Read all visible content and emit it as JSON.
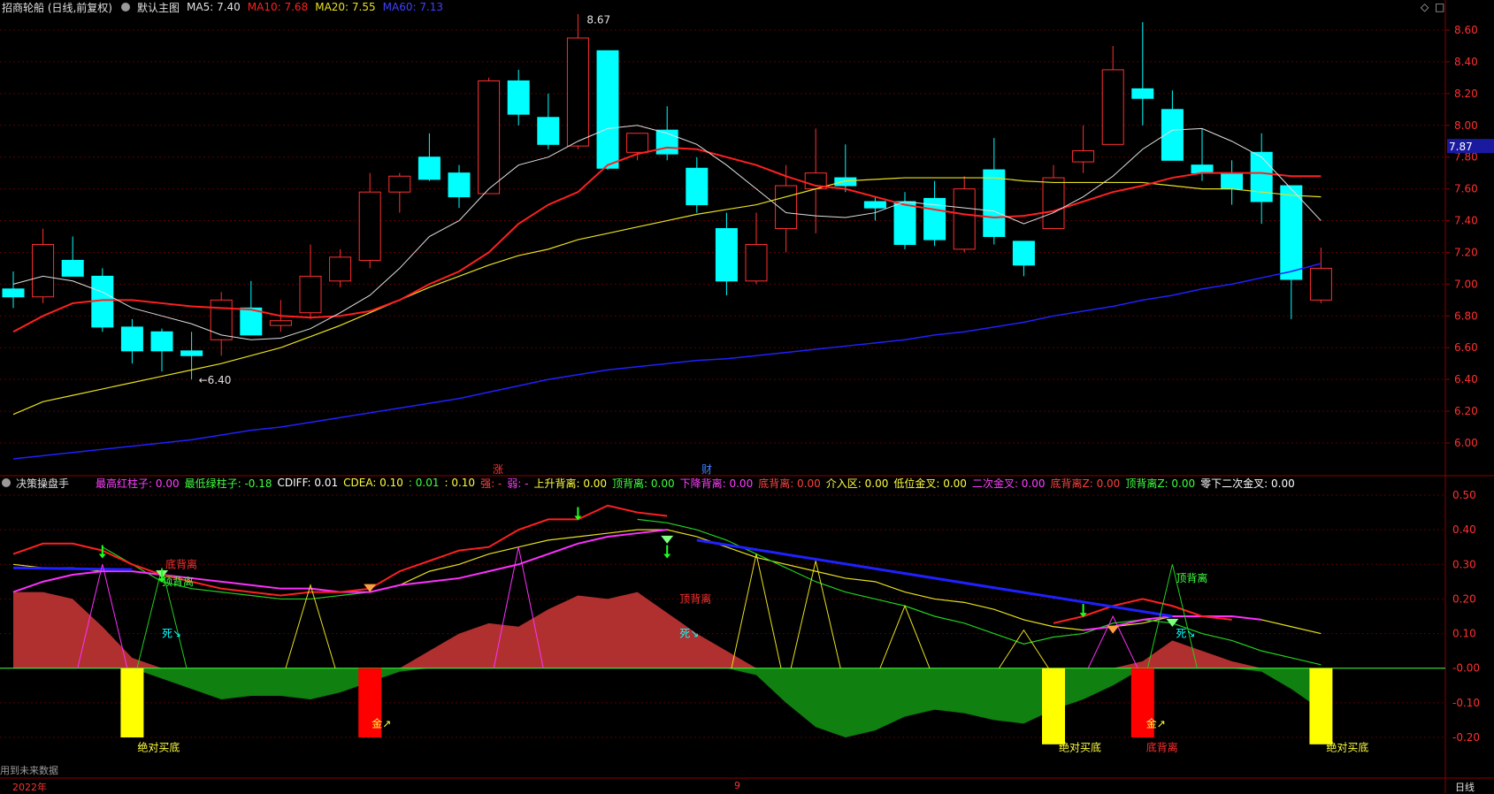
{
  "header": {
    "title": "招商轮船 (日线,前复权)",
    "main_chart": "默认主图",
    "ma5": "MA5: 7.40",
    "ma10": "MA10: 7.68",
    "ma20": "MA20: 7.55",
    "ma60": "MA60: 7.13"
  },
  "colors": {
    "up": "#ff3030",
    "down": "#00ffff",
    "ma5": "#e0e0e0",
    "ma10": "#ff2020",
    "ma20": "#e8e020",
    "ma60": "#2020ff",
    "cyan": "#00ffff"
  },
  "price_axis": [
    "8.60",
    "8.40",
    "8.20",
    "8.00",
    "7.80",
    "7.60",
    "7.40",
    "7.20",
    "7.00",
    "6.80",
    "6.60",
    "6.40",
    "6.20",
    "6.00"
  ],
  "current_price": "7.87",
  "high_label": "8.67",
  "low_label": "6.40",
  "candles": [
    {
      "o": 6.97,
      "h": 7.08,
      "l": 6.85,
      "c": 6.92
    },
    {
      "o": 6.92,
      "h": 7.35,
      "l": 6.88,
      "c": 7.25
    },
    {
      "o": 7.15,
      "h": 7.3,
      "l": 7.08,
      "c": 7.05
    },
    {
      "o": 7.05,
      "h": 7.1,
      "l": 6.7,
      "c": 6.73
    },
    {
      "o": 6.73,
      "h": 6.78,
      "l": 6.5,
      "c": 6.58
    },
    {
      "o": 6.7,
      "h": 6.72,
      "l": 6.45,
      "c": 6.58
    },
    {
      "o": 6.58,
      "h": 6.7,
      "l": 6.4,
      "c": 6.55
    },
    {
      "o": 6.65,
      "h": 6.95,
      "l": 6.55,
      "c": 6.9
    },
    {
      "o": 6.85,
      "h": 7.02,
      "l": 6.7,
      "c": 6.68
    },
    {
      "o": 6.74,
      "h": 6.9,
      "l": 6.7,
      "c": 6.77
    },
    {
      "o": 6.82,
      "h": 7.25,
      "l": 6.78,
      "c": 7.05
    },
    {
      "o": 7.02,
      "h": 7.22,
      "l": 6.98,
      "c": 7.17
    },
    {
      "o": 7.15,
      "h": 7.7,
      "l": 7.1,
      "c": 7.58
    },
    {
      "o": 7.58,
      "h": 7.7,
      "l": 7.45,
      "c": 7.68
    },
    {
      "o": 7.8,
      "h": 7.95,
      "l": 7.65,
      "c": 7.66
    },
    {
      "o": 7.7,
      "h": 7.75,
      "l": 7.48,
      "c": 7.55
    },
    {
      "o": 7.57,
      "h": 8.3,
      "l": 7.57,
      "c": 8.28
    },
    {
      "o": 8.28,
      "h": 8.35,
      "l": 8.0,
      "c": 8.07
    },
    {
      "o": 8.05,
      "h": 8.2,
      "l": 7.85,
      "c": 7.88
    },
    {
      "o": 7.87,
      "h": 8.7,
      "l": 7.85,
      "c": 8.55
    },
    {
      "o": 8.47,
      "h": 8.47,
      "l": 7.72,
      "c": 7.73
    },
    {
      "o": 7.83,
      "h": 7.95,
      "l": 7.78,
      "c": 7.95
    },
    {
      "o": 7.97,
      "h": 8.12,
      "l": 7.78,
      "c": 7.82
    },
    {
      "o": 7.73,
      "h": 7.8,
      "l": 7.45,
      "c": 7.5
    },
    {
      "o": 7.35,
      "h": 7.45,
      "l": 6.93,
      "c": 7.02
    },
    {
      "o": 7.02,
      "h": 7.45,
      "l": 7.0,
      "c": 7.25
    },
    {
      "o": 7.35,
      "h": 7.75,
      "l": 7.2,
      "c": 7.62
    },
    {
      "o": 7.6,
      "h": 7.98,
      "l": 7.32,
      "c": 7.7
    },
    {
      "o": 7.67,
      "h": 7.88,
      "l": 7.58,
      "c": 7.62
    },
    {
      "o": 7.52,
      "h": 7.55,
      "l": 7.4,
      "c": 7.48
    },
    {
      "o": 7.52,
      "h": 7.58,
      "l": 7.22,
      "c": 7.25
    },
    {
      "o": 7.54,
      "h": 7.65,
      "l": 7.24,
      "c": 7.28
    },
    {
      "o": 7.22,
      "h": 7.68,
      "l": 7.2,
      "c": 7.6
    },
    {
      "o": 7.72,
      "h": 7.92,
      "l": 7.25,
      "c": 7.3
    },
    {
      "o": 7.27,
      "h": 7.27,
      "l": 7.05,
      "c": 7.12
    },
    {
      "o": 7.35,
      "h": 7.75,
      "l": 7.35,
      "c": 7.67
    },
    {
      "o": 7.77,
      "h": 8.0,
      "l": 7.7,
      "c": 7.84
    },
    {
      "o": 7.88,
      "h": 8.5,
      "l": 7.88,
      "c": 8.35
    },
    {
      "o": 8.23,
      "h": 8.65,
      "l": 8.0,
      "c": 8.17
    },
    {
      "o": 8.1,
      "h": 8.22,
      "l": 7.78,
      "c": 7.78
    },
    {
      "o": 7.75,
      "h": 7.98,
      "l": 7.65,
      "c": 7.7
    },
    {
      "o": 7.7,
      "h": 7.78,
      "l": 7.5,
      "c": 7.6
    },
    {
      "o": 7.83,
      "h": 7.95,
      "l": 7.38,
      "c": 7.52
    },
    {
      "o": 7.62,
      "h": 7.62,
      "l": 6.78,
      "c": 7.03
    },
    {
      "o": 6.9,
      "h": 7.23,
      "l": 6.88,
      "c": 7.1
    }
  ],
  "ma5_line": [
    7.0,
    7.05,
    7.02,
    6.95,
    6.85,
    6.8,
    6.75,
    6.68,
    6.65,
    6.66,
    6.72,
    6.82,
    6.93,
    7.1,
    7.3,
    7.4,
    7.6,
    7.75,
    7.8,
    7.9,
    7.98,
    8.0,
    7.95,
    7.88,
    7.75,
    7.6,
    7.45,
    7.43,
    7.42,
    7.45,
    7.52,
    7.5,
    7.48,
    7.46,
    7.38,
    7.45,
    7.55,
    7.68,
    7.85,
    7.97,
    7.98,
    7.9,
    7.8,
    7.6,
    7.4
  ],
  "ma10_line": [
    6.7,
    6.8,
    6.88,
    6.9,
    6.9,
    6.88,
    6.86,
    6.85,
    6.84,
    6.8,
    6.79,
    6.8,
    6.83,
    6.9,
    7.0,
    7.08,
    7.2,
    7.38,
    7.5,
    7.58,
    7.75,
    7.82,
    7.86,
    7.85,
    7.8,
    7.75,
    7.68,
    7.62,
    7.6,
    7.55,
    7.5,
    7.47,
    7.44,
    7.42,
    7.43,
    7.46,
    7.52,
    7.58,
    7.62,
    7.67,
    7.7,
    7.7,
    7.7,
    7.68,
    7.68
  ],
  "ma20_line": [
    6.18,
    6.26,
    6.3,
    6.34,
    6.38,
    6.42,
    6.46,
    6.5,
    6.55,
    6.6,
    6.67,
    6.74,
    6.82,
    6.9,
    6.98,
    7.05,
    7.12,
    7.18,
    7.22,
    7.28,
    7.32,
    7.36,
    7.4,
    7.44,
    7.47,
    7.5,
    7.55,
    7.6,
    7.65,
    7.66,
    7.67,
    7.67,
    7.67,
    7.67,
    7.65,
    7.64,
    7.64,
    7.64,
    7.64,
    7.62,
    7.6,
    7.6,
    7.58,
    7.56,
    7.55
  ],
  "ma60_line": [
    5.9,
    5.92,
    5.94,
    5.96,
    5.98,
    6.0,
    6.02,
    6.05,
    6.08,
    6.1,
    6.13,
    6.16,
    6.19,
    6.22,
    6.25,
    6.28,
    6.32,
    6.36,
    6.4,
    6.43,
    6.46,
    6.48,
    6.5,
    6.52,
    6.53,
    6.55,
    6.57,
    6.59,
    6.61,
    6.63,
    6.65,
    6.68,
    6.7,
    6.73,
    6.76,
    6.8,
    6.83,
    6.86,
    6.9,
    6.93,
    6.97,
    7.0,
    7.04,
    7.08,
    7.13
  ],
  "indicator": {
    "name": "决策操盘手",
    "labels": [
      {
        "t": "最高红柱子: 0.00",
        "c": "#ff40ff"
      },
      {
        "t": "最低绿柱子: -0.18",
        "c": "#40ff40"
      },
      {
        "t": "CDIFF: 0.01",
        "c": "#ffffff"
      },
      {
        "t": "CDEA: 0.10",
        "c": "#ffff40"
      },
      {
        "t": ": 0.01",
        "c": "#40ff40"
      },
      {
        "t": ": 0.10",
        "c": "#ffff40"
      },
      {
        "t": "强: -",
        "c": "#ff4040"
      },
      {
        "t": "弱: -",
        "c": "#ff40ff"
      },
      {
        "t": "上升背离: 0.00",
        "c": "#ffff40"
      },
      {
        "t": "顶背离: 0.00",
        "c": "#40ff40"
      },
      {
        "t": "下降背离: 0.00",
        "c": "#ff40ff"
      },
      {
        "t": "底背离: 0.00",
        "c": "#ff4040"
      },
      {
        "t": "介入区: 0.00",
        "c": "#ffff40"
      },
      {
        "t": "低位金叉: 0.00",
        "c": "#ffff40"
      },
      {
        "t": "二次金叉: 0.00",
        "c": "#ff40ff"
      },
      {
        "t": "底背离Z: 0.00",
        "c": "#ff4040"
      },
      {
        "t": "顶背离Z: 0.00",
        "c": "#40ff40"
      },
      {
        "t": "零下二次金叉: 0.00",
        "c": "#ffffff"
      }
    ],
    "axis": [
      "0.50",
      "0.40",
      "0.30",
      "0.20",
      "0.10",
      "-0.00",
      "-0.10",
      "-0.20"
    ],
    "tag_zhang": "涨",
    "tag_cai": "财",
    "annotations": {
      "dibeili": "底背离",
      "dingbeili": "顶背离",
      "si": "死↘",
      "jin": "金↗",
      "juedui": "绝对买底"
    }
  },
  "footer": {
    "year": "2022年",
    "period": "日线",
    "note": "用到未来数据",
    "mid": "9"
  }
}
